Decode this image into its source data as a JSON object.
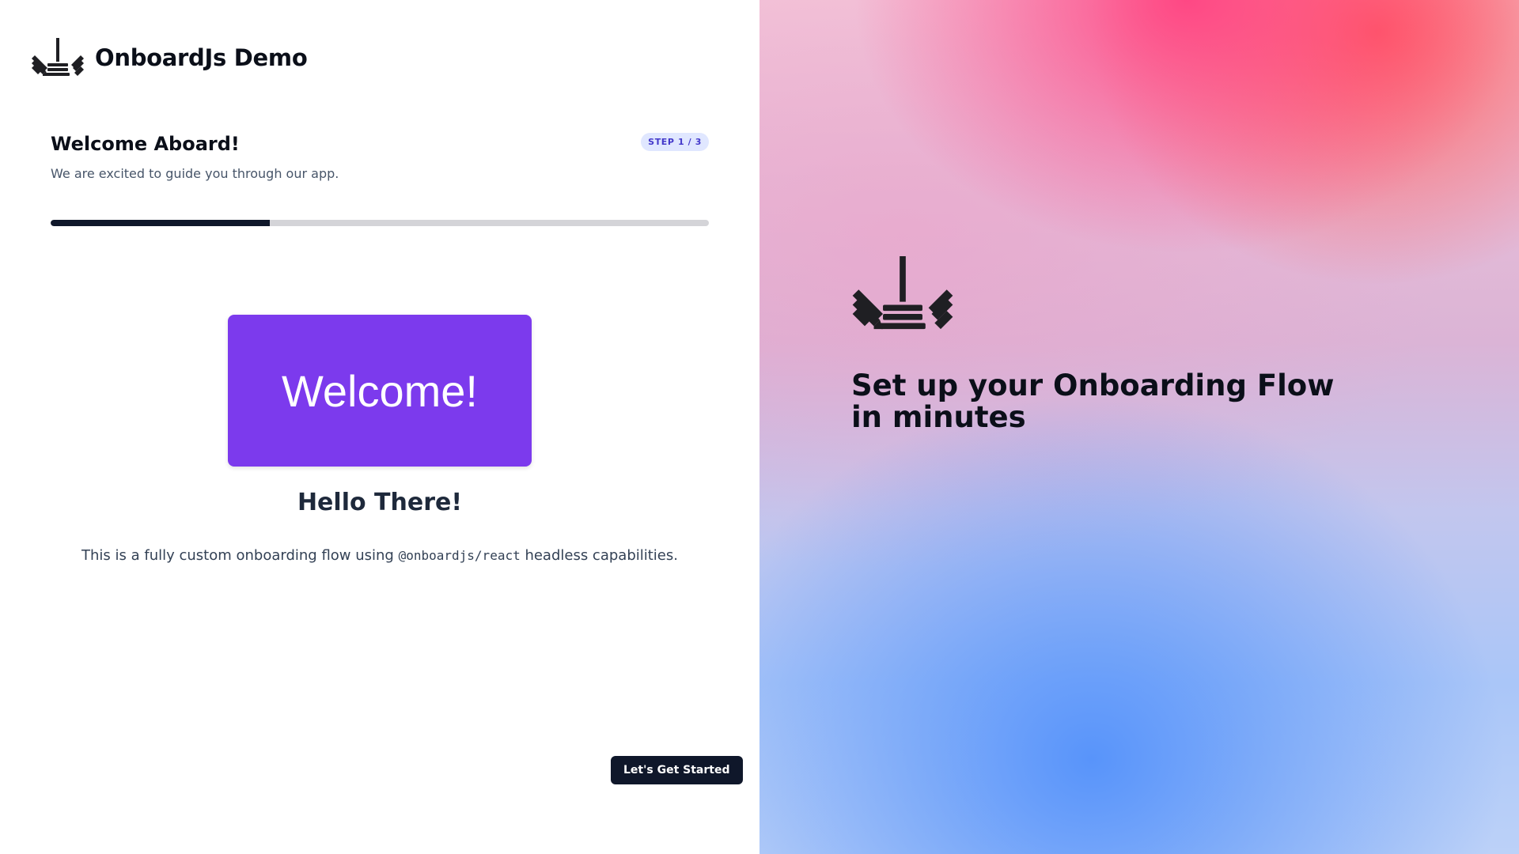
{
  "brand": {
    "title": "OnboardJs Demo",
    "logo_icon": "onboardjs-logo-icon"
  },
  "step": {
    "title": "Welcome Aboard!",
    "subtitle": "We are excited to guide you through our app.",
    "badge": "STEP 1 / 3",
    "current": 1,
    "total": 3,
    "progress_fraction": 0.333
  },
  "content": {
    "hero_text": "Welcome!",
    "heading": "Hello There!",
    "description_before": "This is a fully custom onboarding flow using ",
    "description_code": "@onboardjs/react",
    "description_after": " headless capabilities."
  },
  "actions": {
    "next_label": "Let's Get Started"
  },
  "aside": {
    "logo_icon": "onboardjs-logo-icon",
    "tagline": "Set up your Onboarding Flow in minutes"
  },
  "colors": {
    "hero_card": "#7c3aed",
    "primary_button": "#0f172a",
    "badge_bg": "#e0e7ff",
    "badge_text": "#4338ca",
    "progress_fill": "#0f172a",
    "progress_track": "#d4d4d8"
  }
}
